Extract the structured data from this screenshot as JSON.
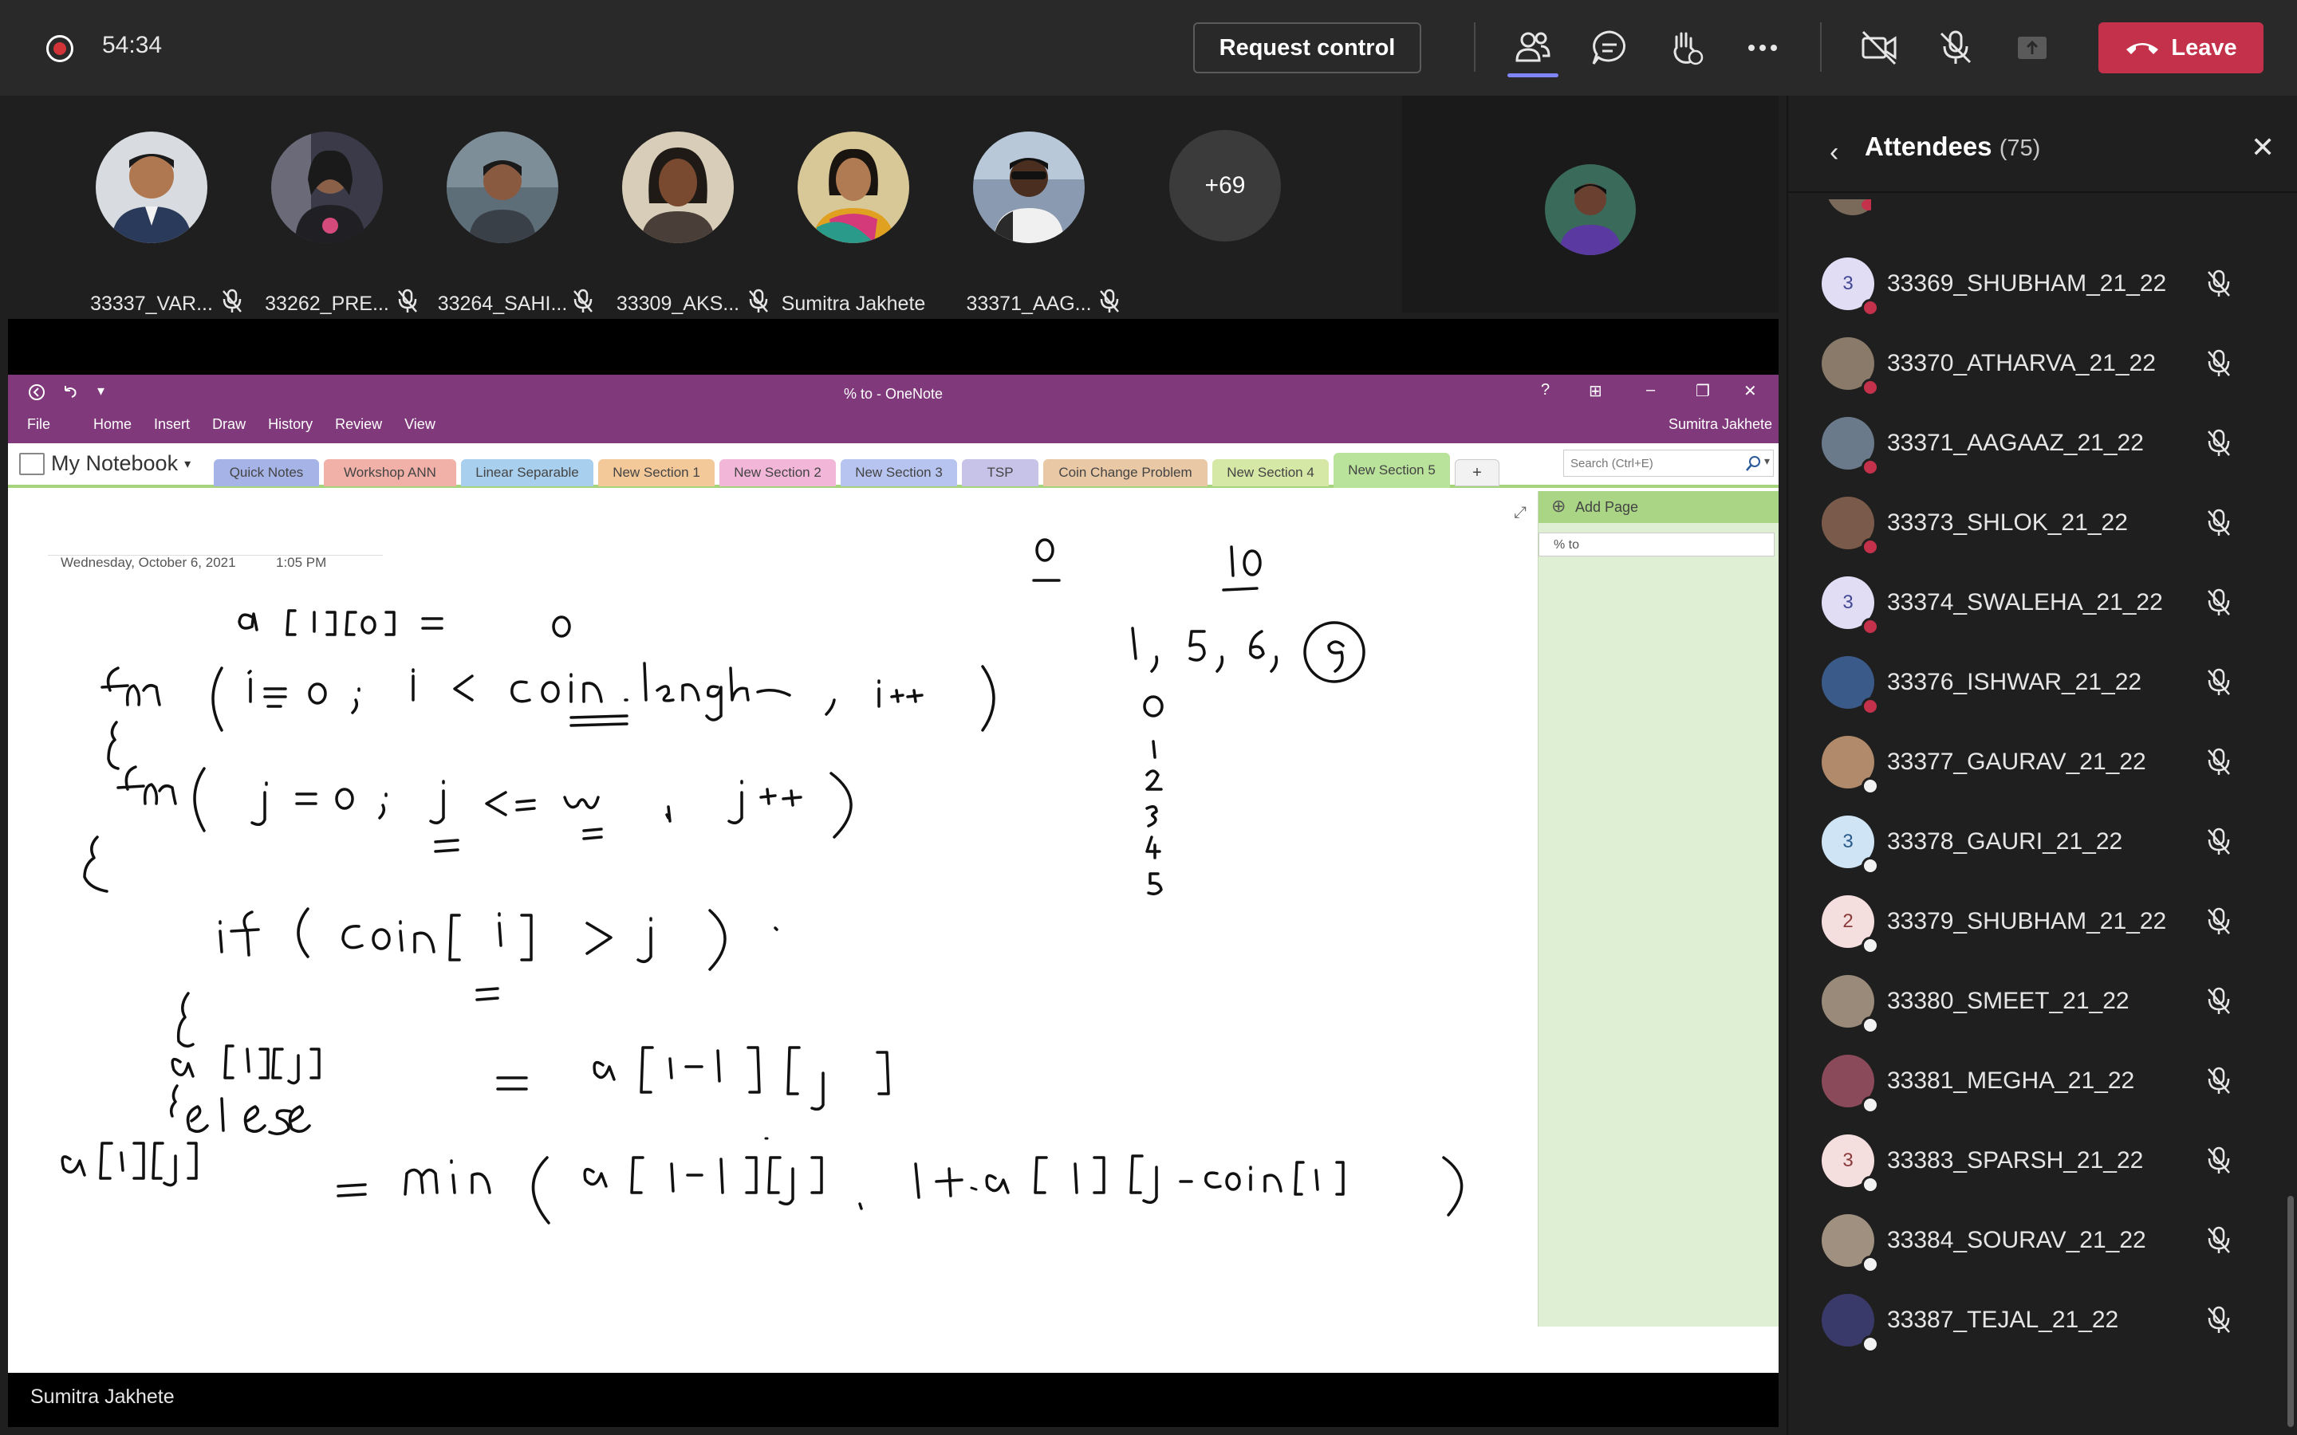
{
  "topbar": {
    "timer": "54:34",
    "request_control": "Request control",
    "leave": "Leave"
  },
  "participants": [
    {
      "name": "33337_VAR...",
      "avatar_color": "#3b4a6b"
    },
    {
      "name": "33262_PRE...",
      "avatar_color": "#2e2e3e"
    },
    {
      "name": "33264_SAHI...",
      "avatar_color": "#6b7d8a"
    },
    {
      "name": "33309_AKS...",
      "avatar_color": "#5a4030"
    },
    {
      "name": "Sumitra Jakhete",
      "avatar_color": "#c9a23a"
    },
    {
      "name": "33371_AAG...",
      "avatar_color": "#7a8a9a"
    }
  ],
  "more_participants": "+69",
  "onenote": {
    "window_title": "% to - OneNote",
    "user": "Sumitra Jakhete",
    "menu": [
      "File",
      "Home",
      "Insert",
      "Draw",
      "History",
      "Review",
      "View"
    ],
    "notebook": "My Notebook",
    "tabs": [
      {
        "label": "Quick Notes",
        "color": "#a5b3e6"
      },
      {
        "label": "Workshop ANN",
        "color": "#f1b1a8"
      },
      {
        "label": "Linear Separable",
        "color": "#a8cfee"
      },
      {
        "label": "New Section 1",
        "color": "#f4c99a"
      },
      {
        "label": "New Section 2",
        "color": "#f2b6d8"
      },
      {
        "label": "New Section 3",
        "color": "#b6c4ef"
      },
      {
        "label": "TSP",
        "color": "#c7c3e8"
      },
      {
        "label": "Coin Change Problem",
        "color": "#e9c8a6"
      },
      {
        "label": "New Section 4",
        "color": "#d6e8a6"
      },
      {
        "label": "New Section 5",
        "color": "#b9e29a"
      }
    ],
    "add_tab": "+",
    "search_placeholder": "Search (Ctrl+E)",
    "date": "Wednesday, October 6, 2021",
    "time": "1:05 PM",
    "add_page": "Add Page",
    "page_title": "% to"
  },
  "presenter": "Sumitra Jakhete",
  "attendees_panel": {
    "title": "Attendees",
    "count": "(75)",
    "attendees": [
      {
        "name": "33369_SHUBHAM_21_22",
        "initial": "3",
        "avatar_color": "#e0ddf5",
        "text_color": "#444791",
        "status": "busy"
      },
      {
        "name": "33370_ATHARVA_21_22",
        "initial": "",
        "avatar_color": "#8a7a6a",
        "text_color": "#fff",
        "status": "busy"
      },
      {
        "name": "33371_AAGAAZ_21_22",
        "initial": "",
        "avatar_color": "#6a7a8a",
        "text_color": "#fff",
        "status": "busy"
      },
      {
        "name": "33373_SHLOK_21_22",
        "initial": "",
        "avatar_color": "#7a5a4a",
        "text_color": "#fff",
        "status": "busy"
      },
      {
        "name": "33374_SWALEHA_21_22",
        "initial": "3",
        "avatar_color": "#e0ddf5",
        "text_color": "#444791",
        "status": "busy"
      },
      {
        "name": "33376_ISHWAR_21_22",
        "initial": "",
        "avatar_color": "#3a5a8a",
        "text_color": "#fff",
        "status": "busy"
      },
      {
        "name": "33377_GAURAV_21_22",
        "initial": "",
        "avatar_color": "#b08a6a",
        "text_color": "#fff",
        "status": "offline"
      },
      {
        "name": "33378_GAURI_21_22",
        "initial": "3",
        "avatar_color": "#cfe4f5",
        "text_color": "#2a5a8a",
        "status": "offline"
      },
      {
        "name": "33379_SHUBHAM_21_22",
        "initial": "2",
        "avatar_color": "#f5dede",
        "text_color": "#8a3a3a",
        "status": "offline"
      },
      {
        "name": "33380_SMEET_21_22",
        "initial": "",
        "avatar_color": "#9a8a7a",
        "text_color": "#fff",
        "status": "offline"
      },
      {
        "name": "33381_MEGHA_21_22",
        "initial": "",
        "avatar_color": "#8a4a5a",
        "text_color": "#fff",
        "status": "offline"
      },
      {
        "name": "33383_SPARSH_21_22",
        "initial": "3",
        "avatar_color": "#f5dede",
        "text_color": "#8a3a3a",
        "status": "offline"
      },
      {
        "name": "33384_SOURAV_21_22",
        "initial": "",
        "avatar_color": "#a09080",
        "text_color": "#fff",
        "status": "offline"
      },
      {
        "name": "33387_TEJAL_21_22",
        "initial": "",
        "avatar_color": "#3a3a6a",
        "text_color": "#fff",
        "status": "offline"
      }
    ]
  },
  "colors": {
    "accent": "#7f85f5",
    "leave": "#c4314b",
    "onenote_purple": "#80397b",
    "busy": "#c4314b"
  }
}
